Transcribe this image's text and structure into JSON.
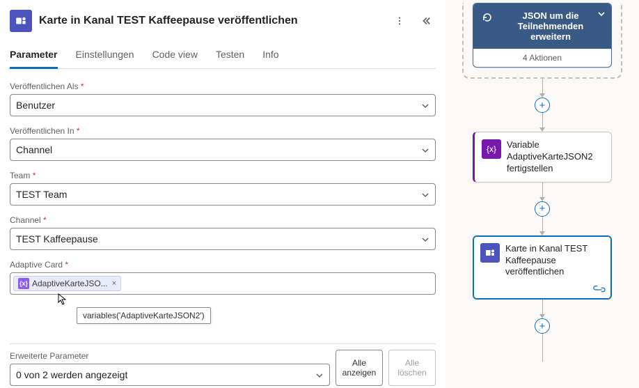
{
  "header": {
    "title": "Karte in Kanal TEST Kaffeepause veröffentlichen"
  },
  "tabs": {
    "parameter": "Parameter",
    "settings": "Einstellungen",
    "codeview": "Code view",
    "test": "Testen",
    "info": "Info"
  },
  "fields": {
    "publishAs": {
      "label": "Veröffentlichen Als",
      "value": "Benutzer"
    },
    "publishIn": {
      "label": "Veröffentlichen In",
      "value": "Channel"
    },
    "team": {
      "label": "Team",
      "value": "TEST Team"
    },
    "channel": {
      "label": "Channel",
      "value": "TEST Kaffeepause"
    },
    "adaptiveCard": {
      "label": "Adaptive Card",
      "token": "AdaptiveKarteJSO..."
    }
  },
  "tooltip": "variables('AdaptiveKarteJSON2')",
  "extended": {
    "label": "Erweiterte Parameter",
    "value": "0 von 2 werden angezeigt",
    "showAll": "Alle anzeigen",
    "clearAll": "Alle löschen"
  },
  "flow": {
    "jsonStep": {
      "title": "JSON um die Teilnehmenden erweitern",
      "actions": "4 Aktionen"
    },
    "varStep": "Variable AdaptiveKarteJSON2 fertigstellen",
    "postStep": "Karte in Kanal TEST Kaffeepause veröffentlichen"
  }
}
